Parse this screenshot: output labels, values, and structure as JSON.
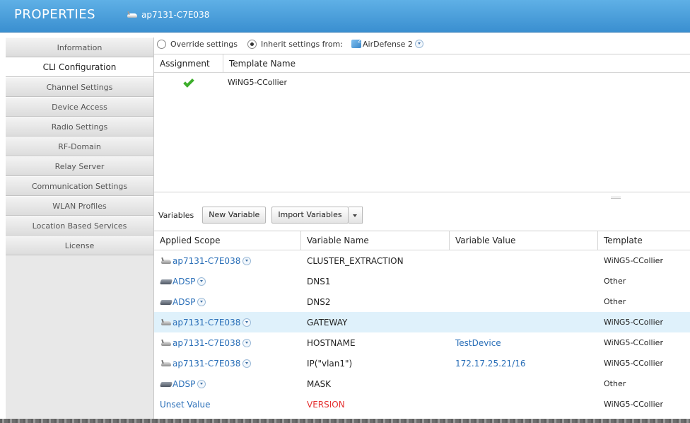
{
  "header": {
    "title": "PROPERTIES",
    "device_name": "ap7131-C7E038"
  },
  "sidebar": {
    "items": [
      {
        "label": "Information",
        "active": false
      },
      {
        "label": "CLI Configuration",
        "active": true
      },
      {
        "label": "Channel Settings",
        "active": false
      },
      {
        "label": "Device Access",
        "active": false
      },
      {
        "label": "Radio Settings",
        "active": false
      },
      {
        "label": "RF-Domain",
        "active": false
      },
      {
        "label": "Relay Server",
        "active": false
      },
      {
        "label": "Communication Settings",
        "active": false
      },
      {
        "label": "WLAN Profiles",
        "active": false
      },
      {
        "label": "Location Based Services",
        "active": false
      },
      {
        "label": "License",
        "active": false
      }
    ]
  },
  "options": {
    "override_label": "Override settings",
    "inherit_label": "Inherit settings from:",
    "inherit_selected": true,
    "inherit_source": "AirDefense 2"
  },
  "templates": {
    "columns": [
      "Assignment",
      "Template Name"
    ],
    "rows": [
      {
        "assigned": true,
        "name": "WiNG5-CCollier"
      }
    ]
  },
  "variables": {
    "label": "Variables",
    "new_button": "New Variable",
    "import_button": "Import Variables",
    "columns": [
      "Applied Scope",
      "Variable Name",
      "Variable Value",
      "Template"
    ],
    "rows": [
      {
        "scope": "ap7131-C7E038",
        "scope_icon": "ap-icon",
        "name": "CLUSTER_EXTRACTION",
        "value": "",
        "template": "WiNG5-CCollier"
      },
      {
        "scope": "ADSP",
        "scope_icon": "adsp-icon",
        "name": "DNS1",
        "value": "",
        "template": "Other"
      },
      {
        "scope": "ADSP",
        "scope_icon": "adsp-icon",
        "name": "DNS2",
        "value": "",
        "template": "Other"
      },
      {
        "scope": "ap7131-C7E038",
        "scope_icon": "ap-icon",
        "name": "GATEWAY",
        "value": "",
        "template": "WiNG5-CCollier",
        "selected": true
      },
      {
        "scope": "ap7131-C7E038",
        "scope_icon": "ap-icon",
        "name": "HOSTNAME",
        "value": "TestDevice",
        "template": "WiNG5-CCollier"
      },
      {
        "scope": "ap7131-C7E038",
        "scope_icon": "ap-icon",
        "name": "IP(\"vlan1\")",
        "value": "172.17.25.21/16",
        "template": "WiNG5-CCollier"
      },
      {
        "scope": "ADSP",
        "scope_icon": "adsp-icon",
        "name": "MASK",
        "value": "",
        "template": "Other"
      },
      {
        "scope": "Unset Value",
        "scope_icon": "",
        "name": "VERSION",
        "value": "",
        "template": "WiNG5-CCollier"
      }
    ]
  },
  "colors": {
    "header_blue": "#3a8fd0",
    "link_blue": "#2a6fb8",
    "error_red": "#e53030",
    "selected_row": "#dff1fb",
    "check_green": "#3dae2b"
  }
}
